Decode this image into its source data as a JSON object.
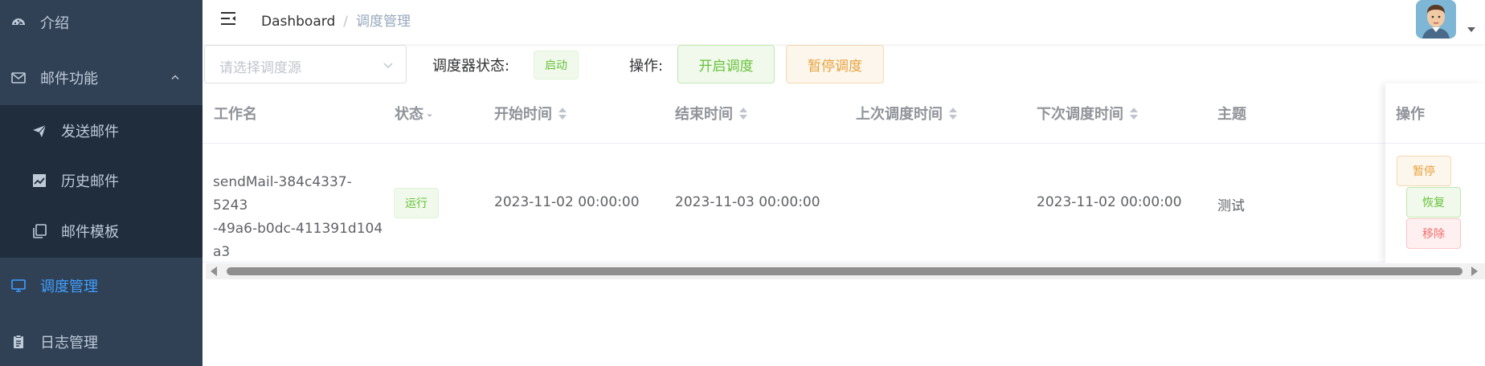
{
  "sidebar": {
    "items": [
      {
        "label": "介绍",
        "icon": "dashboard-icon"
      },
      {
        "label": "邮件功能",
        "icon": "mail-icon"
      },
      {
        "label": "发送邮件",
        "icon": "send-icon"
      },
      {
        "label": "历史邮件",
        "icon": "chart-icon"
      },
      {
        "label": "邮件模板",
        "icon": "copy-icon"
      },
      {
        "label": "调度管理",
        "icon": "monitor-icon"
      },
      {
        "label": "日志管理",
        "icon": "clipboard-icon"
      }
    ],
    "active_color": "#409eff",
    "bg_color": "#304156",
    "submenu_bg_color": "#1f2d3d"
  },
  "navbar": {
    "breadcrumb": [
      "Dashboard",
      "调度管理"
    ]
  },
  "toolbar": {
    "select_placeholder": "请选择调度源",
    "scheduler_status_label": "调度器状态:",
    "scheduler_status": "启动",
    "operation_label": "操作:",
    "start_button": "开启调度",
    "pause_button": "暂停调度"
  },
  "table": {
    "headers": [
      "工作名",
      "状态",
      "开始时间",
      "结束时间",
      "上次调度时间",
      "下次调度时间",
      "主题",
      "操作"
    ],
    "rows": [
      {
        "job_name": [
          "sendMail-384c4337-5243",
          "-49a6-b0dc-411391d104",
          "a3"
        ],
        "status": "运行",
        "start_time": "2023-11-02 00:00:00",
        "end_time": "2023-11-03 00:00:00",
        "last_time": "",
        "next_time": "2023-11-02 00:00:00",
        "subject": "测试",
        "actions": [
          "暂停",
          "恢复",
          "移除"
        ]
      }
    ]
  }
}
